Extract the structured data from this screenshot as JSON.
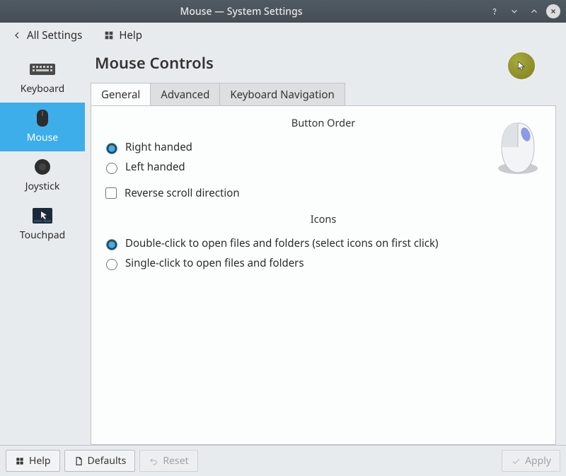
{
  "window": {
    "title": "Mouse — System Settings"
  },
  "toolbar": {
    "all_settings_label": "All Settings",
    "help_label": "Help"
  },
  "sidebar": {
    "items": [
      {
        "label": "Keyboard"
      },
      {
        "label": "Mouse"
      },
      {
        "label": "Joystick"
      },
      {
        "label": "Touchpad"
      }
    ]
  },
  "page": {
    "title": "Mouse Controls"
  },
  "tabs": [
    {
      "label": "General"
    },
    {
      "label": "Advanced"
    },
    {
      "label": "Keyboard Navigation"
    }
  ],
  "general": {
    "button_order_title": "Button Order",
    "right_handed_label": "Right handed",
    "left_handed_label": "Left handed",
    "reverse_scroll_label": "Reverse scroll direction",
    "icons_title": "Icons",
    "double_click_label": "Double-click to open files and folders (select icons on first click)",
    "single_click_label": "Single-click to open files and folders"
  },
  "buttons": {
    "help": "Help",
    "defaults": "Defaults",
    "reset": "Reset",
    "apply": "Apply"
  }
}
